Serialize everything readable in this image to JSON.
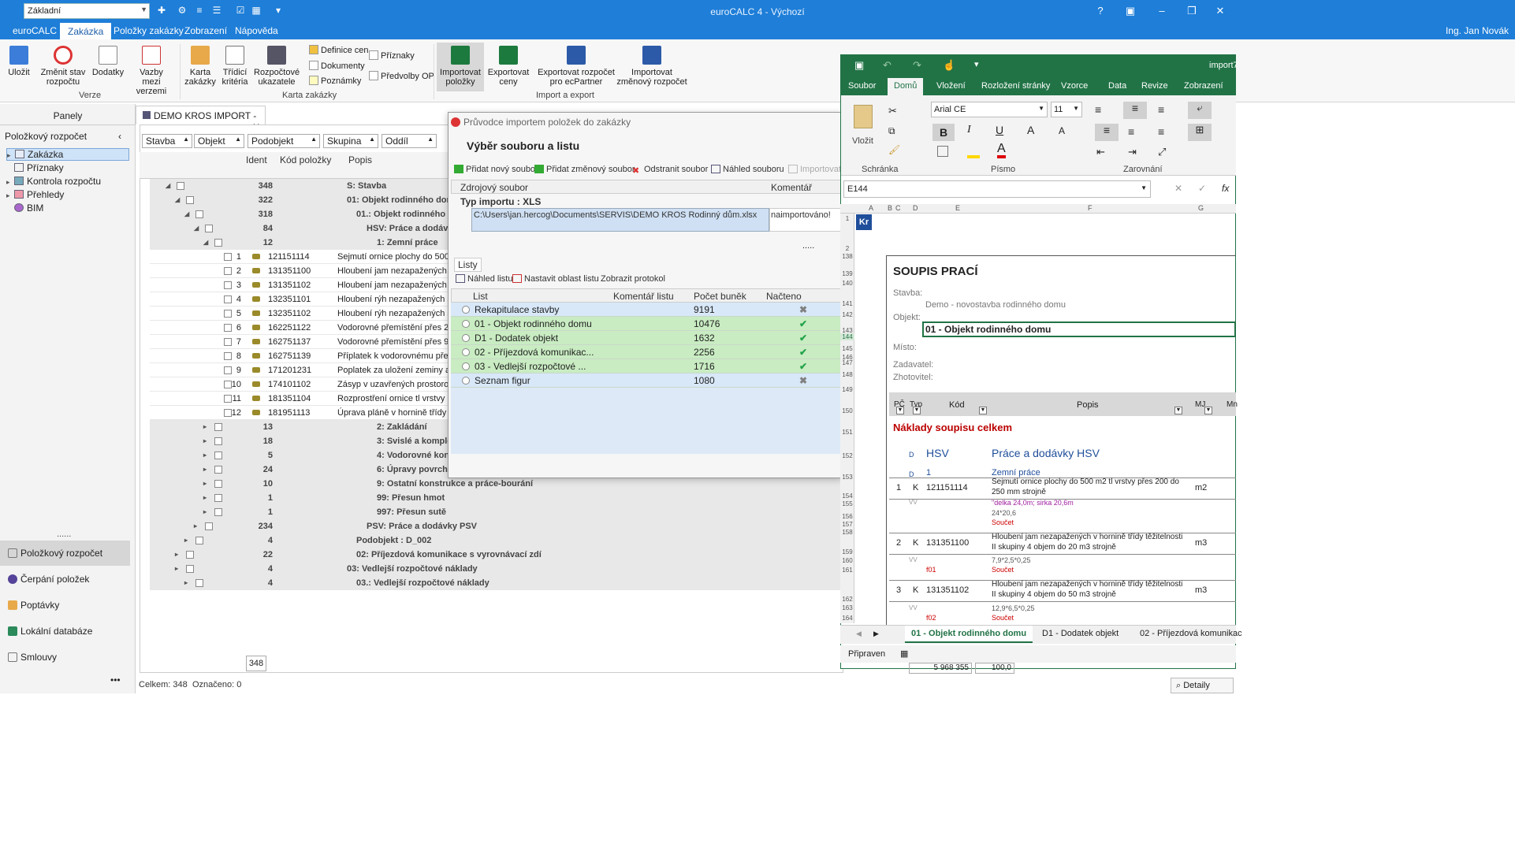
{
  "title_bar": {
    "combo": "Základní",
    "title": "euroCALC 4 - Výchozí"
  },
  "menu": {
    "items": [
      "euroCALC",
      "Zakázka",
      "Položky zakázky",
      "Zobrazení",
      "Nápověda"
    ],
    "user": "Ing. Jan Novák"
  },
  "ribbon": {
    "save": "Uložit",
    "change_state": "Změnit stav rozpočtu",
    "dodatky": "Dodatky",
    "vazby": "Vazby mezi verzemi",
    "group_verze": "Verze",
    "karta": "Karta zakázky",
    "tridici": "Třídicí kritéria",
    "rozpoctove": "Rozpočtové ukazatele",
    "definice": "Definice cen",
    "dokumenty": "Dokumenty",
    "poznamky": "Poznámky",
    "priznaky": "Příznaky",
    "predvolby": "Předvolby OP",
    "group_karta": "Karta zakázky",
    "import_polozky": "Importovat položky",
    "export_ceny": "Exportovat ceny",
    "export_ecpartner": "Exportovat rozpočet pro ecPartner",
    "import_zmeny": "Importovat změnový rozpočet",
    "group_ie": "Import a export"
  },
  "left_panel": {
    "header": "Panely",
    "section": "Položkový rozpočet",
    "tree": [
      "Zakázka",
      "Příznaky",
      "Kontrola rozpočtu",
      "Přehledy",
      "BIM"
    ],
    "nav": [
      "Položkový rozpočet",
      "Čerpání položek",
      "Poptávky",
      "Lokální databáze",
      "Smlouvy"
    ],
    "dots": "......",
    "more": "•••"
  },
  "document": {
    "tab": "DEMO KROS IMPORT - ...",
    "filters": [
      "Stavba",
      "Objekt",
      "Podobjekt",
      "Skupina",
      "Oddíl"
    ],
    "columns": {
      "ident": "Ident",
      "kod": "Kód položky",
      "popis": "Popis"
    },
    "rows": [
      {
        "cnt": "348",
        "desc": "S: Stavba"
      },
      {
        "cnt": "322",
        "desc": "01: Objekt rodinného domu"
      },
      {
        "cnt": "318",
        "desc": "01.: Objekt rodinného d"
      },
      {
        "cnt": "84",
        "desc": "HSV: Práce a dodávky"
      },
      {
        "cnt": "12",
        "desc": "1: Zemní práce"
      },
      {
        "id": "1",
        "kod": "121151114",
        "desc": "Sejmutí ornice plochy do 500"
      },
      {
        "id": "2",
        "kod": "131351100",
        "desc": "Hloubení jam nezapažených v"
      },
      {
        "id": "3",
        "kod": "131351102",
        "desc": "Hloubení jam nezapažených v"
      },
      {
        "id": "4",
        "kod": "132351101",
        "desc": "Hloubení rýh nezapažených š"
      },
      {
        "id": "5",
        "kod": "132351102",
        "desc": "Hloubení rýh nezapažených š"
      },
      {
        "id": "6",
        "kod": "162251122",
        "desc": "Vodorovné přemístění přes 2"
      },
      {
        "id": "7",
        "kod": "162751137",
        "desc": "Vodorovné přemístění přes 9"
      },
      {
        "id": "8",
        "kod": "162751139",
        "desc": "Příplatek k vodorovnému přem"
      },
      {
        "id": "9",
        "kod": "171201231",
        "desc": "Poplatek za uložení zeminy a"
      },
      {
        "id": "10",
        "kod": "174101102",
        "desc": "Zásyp v uzavřených prostoroc"
      },
      {
        "id": "11",
        "kod": "181351104",
        "desc": "Rozprostření ornice tl vrstvy p"
      },
      {
        "id": "12",
        "kod": "181951113",
        "desc": "Úprava pláně v hornině třídy t"
      },
      {
        "cnt": "13",
        "desc": "2: Zakládání"
      },
      {
        "cnt": "18",
        "desc": "3: Svislé a komplet"
      },
      {
        "cnt": "5",
        "desc": "4: Vodorovné kons"
      },
      {
        "cnt": "24",
        "desc": "6: Úpravy povrchů"
      },
      {
        "cnt": "10",
        "desc": "9: Ostatní konstrukce a práce-bourání"
      },
      {
        "cnt": "1",
        "desc": "99: Přesun hmot"
      },
      {
        "cnt": "1",
        "desc": "997: Přesun sutě"
      },
      {
        "cnt": "234",
        "desc": "PSV: Práce a dodávky PSV"
      },
      {
        "cnt": "4",
        "desc": "Podobjekt : D_002"
      },
      {
        "cnt": "22",
        "desc": "02: Příjezdová komunikace s vyrovnávací zdí"
      },
      {
        "cnt": "4",
        "desc": "03: Vedlejší rozpočtové náklady"
      },
      {
        "cnt": "4",
        "desc": "03.: Vedlejší rozpočtové náklady"
      }
    ],
    "footer_value": "348",
    "status": {
      "celkem": "Celkem: 348",
      "oznaceno": "Označeno: 0"
    }
  },
  "dialog": {
    "title": "Průvodce importem položek do zakázky",
    "heading": "Výběr souboru a listu",
    "toolbar": [
      "Přidat nový soubor",
      "Přidat změnový soubor",
      "Odstranit soubor",
      "Náhled souboru",
      "Importovat"
    ],
    "col_source": "Zdrojový soubor",
    "col_comment": "Komentář",
    "type_import": "Typ importu : XLS",
    "file_path": "C:\\Users\\jan.hercog\\Documents\\SERVIS\\DEMO KROS Rodinný dům.xlsx",
    "file_comment": "naimportováno!",
    "dots": ".....",
    "sheets_tab": "Listy",
    "sheets_toolbar": [
      "Náhled listu",
      "Nastavit oblast listu",
      "Zobrazit protokol"
    ],
    "sheet_cols": {
      "list": "List",
      "komentar": "Komentář listu",
      "pocet": "Počet buněk",
      "nacteno": "Načteno"
    },
    "sheets": [
      {
        "name": "Rekapitulace stavby",
        "count": "9191",
        "status": "✖",
        "color": "b"
      },
      {
        "name": "01 - Objekt rodinného domu",
        "count": "10476",
        "status": "✔",
        "color": "g"
      },
      {
        "name": "D1 - Dodatek objekt",
        "count": "1632",
        "status": "✔",
        "color": "g"
      },
      {
        "name": "02 - Příjezdová komunikac...",
        "count": "2256",
        "status": "✔",
        "color": "g"
      },
      {
        "name": "03 - Vedlejší rozpočtové ...",
        "count": "1716",
        "status": "✔",
        "color": "g"
      },
      {
        "name": "Seznam figur",
        "count": "1080",
        "status": "✖",
        "color": "b"
      }
    ],
    "colors": {
      "ok": "#22a34a",
      "no": "#808080"
    }
  },
  "excel": {
    "title": "import7",
    "tabs": [
      "Soubor",
      "Domů",
      "Vložení",
      "Rozložení stránky",
      "Vzorce",
      "Data",
      "Revize",
      "Zobrazení"
    ],
    "paste": "Vložit",
    "schranka": "Schránka",
    "font_name": "Arial CE",
    "font_size": "11",
    "pismo": "Písmo",
    "zarovnani": "Zarovnání",
    "cell_ref": "E144",
    "col_headers": [
      "A",
      "B",
      "C",
      "D",
      "E",
      "F",
      "G"
    ],
    "row_numbers": [
      "1",
      "2",
      "138",
      "139",
      "140",
      "141",
      "142",
      "143",
      "144",
      "145",
      "146",
      "147",
      "148",
      "149",
      "150",
      "151",
      "152",
      "153",
      "154",
      "155",
      "156",
      "157",
      "158",
      "159",
      "160",
      "161",
      "162",
      "163",
      "164"
    ],
    "sheet": {
      "title": "SOUPIS PRACÍ",
      "stavba_label": "Stavba:",
      "stavba": "Demo - novostavba rodinného domu",
      "objekt_label": "Objekt:",
      "objekt": "01 - Objekt rodinného domu",
      "misto": "Místo:",
      "zadavatel": "Zadavatel:",
      "zhotovitel": "Zhotovitel:",
      "hdr_pc": "PČ",
      "hdr_typ": "Typ",
      "hdr_kod": "Kód",
      "hdr_popis": "Popis",
      "hdr_mj": "MJ",
      "hdr_mn": "Mn",
      "naklady": "Náklady soupisu celkem",
      "d": "D",
      "hsv": "HSV",
      "hsv_desc": "Práce a dodávky HSV",
      "d1": "1",
      "zemni": "Zemní práce",
      "items": [
        {
          "pc": "1",
          "typ": "K",
          "kod": "121151114",
          "popis1": "Sejmutí ornice plochy do 500 m2 tl vrstvy přes 200 do",
          "popis2": "250 mm strojně",
          "mj": "m2"
        },
        {
          "pc": "2",
          "typ": "K",
          "kod": "131351100",
          "popis1": "Hloubení jam nezapažených v hornině třídy těžitelnosti",
          "popis2": "II skupiny 4 objem do 20 m3 strojně",
          "mj": "m3"
        },
        {
          "pc": "3",
          "typ": "K",
          "kod": "131351102",
          "popis1": "Hloubení jam nezapažených v hornině třídy těžitelnosti",
          "popis2": "II skupiny 4 objem do 50 m3 strojně",
          "mj": "m3"
        }
      ],
      "vv1": "\"delka 24,0m; sirka 20,6m",
      "vv2": "24*20,6",
      "soucet": "Součet",
      "vv3": "7,9*2,5*0,25",
      "f01": "f01",
      "vv4": "12,9*6,5*0,25",
      "f02": "f02",
      "vv": "VV"
    },
    "sheet_tabs": [
      "01 - Objekt rodinného domu",
      "D1 - Dodatek objekt",
      "02 - Příjezdová komunikac"
    ],
    "status": "Připraven",
    "detail": "Detaily",
    "bottom_vals": [
      "5 968 355",
      "100,0"
    ]
  }
}
